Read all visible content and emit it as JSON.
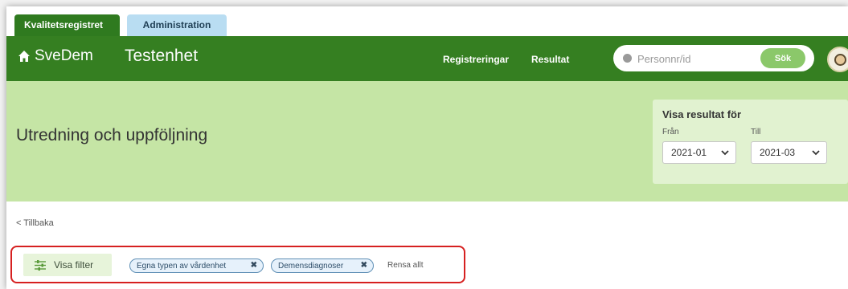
{
  "tabs": [
    {
      "label": "Kvalitetsregistret",
      "active": true
    },
    {
      "label": "Administration",
      "active": false
    }
  ],
  "header": {
    "brand": "SveDem",
    "unit": "Testenhet",
    "nav": [
      {
        "label": "Registreringar"
      },
      {
        "label": "Resultat"
      }
    ],
    "search": {
      "placeholder": "Personnr/id",
      "button": "Sök"
    }
  },
  "banner": {
    "title": "Utredning och uppföljning",
    "results": {
      "title": "Visa resultat för",
      "from_label": "Från",
      "to_label": "Till",
      "from_value": "2021-01",
      "to_value": "2021-03"
    }
  },
  "back": "< Tillbaka",
  "filters": {
    "button": "Visa filter",
    "chips": [
      {
        "label": "Egna typen av vårdenhet"
      },
      {
        "label": "Demensdiagnoser"
      }
    ],
    "clear": "Rensa allt"
  },
  "colors": {
    "header_green": "#357f21",
    "banner_green": "#c5e5a5",
    "highlight_red": "#d62020"
  }
}
